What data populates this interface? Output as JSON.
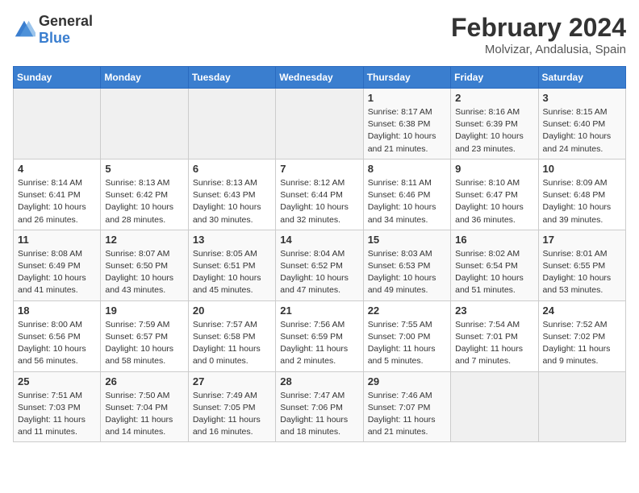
{
  "logo": {
    "text_general": "General",
    "text_blue": "Blue"
  },
  "title": {
    "month": "February 2024",
    "location": "Molvizar, Andalusia, Spain"
  },
  "weekdays": [
    "Sunday",
    "Monday",
    "Tuesday",
    "Wednesday",
    "Thursday",
    "Friday",
    "Saturday"
  ],
  "weeks": [
    [
      {
        "day": "",
        "info": ""
      },
      {
        "day": "",
        "info": ""
      },
      {
        "day": "",
        "info": ""
      },
      {
        "day": "",
        "info": ""
      },
      {
        "day": "1",
        "info": "Sunrise: 8:17 AM\nSunset: 6:38 PM\nDaylight: 10 hours and 21 minutes."
      },
      {
        "day": "2",
        "info": "Sunrise: 8:16 AM\nSunset: 6:39 PM\nDaylight: 10 hours and 23 minutes."
      },
      {
        "day": "3",
        "info": "Sunrise: 8:15 AM\nSunset: 6:40 PM\nDaylight: 10 hours and 24 minutes."
      }
    ],
    [
      {
        "day": "4",
        "info": "Sunrise: 8:14 AM\nSunset: 6:41 PM\nDaylight: 10 hours and 26 minutes."
      },
      {
        "day": "5",
        "info": "Sunrise: 8:13 AM\nSunset: 6:42 PM\nDaylight: 10 hours and 28 minutes."
      },
      {
        "day": "6",
        "info": "Sunrise: 8:13 AM\nSunset: 6:43 PM\nDaylight: 10 hours and 30 minutes."
      },
      {
        "day": "7",
        "info": "Sunrise: 8:12 AM\nSunset: 6:44 PM\nDaylight: 10 hours and 32 minutes."
      },
      {
        "day": "8",
        "info": "Sunrise: 8:11 AM\nSunset: 6:46 PM\nDaylight: 10 hours and 34 minutes."
      },
      {
        "day": "9",
        "info": "Sunrise: 8:10 AM\nSunset: 6:47 PM\nDaylight: 10 hours and 36 minutes."
      },
      {
        "day": "10",
        "info": "Sunrise: 8:09 AM\nSunset: 6:48 PM\nDaylight: 10 hours and 39 minutes."
      }
    ],
    [
      {
        "day": "11",
        "info": "Sunrise: 8:08 AM\nSunset: 6:49 PM\nDaylight: 10 hours and 41 minutes."
      },
      {
        "day": "12",
        "info": "Sunrise: 8:07 AM\nSunset: 6:50 PM\nDaylight: 10 hours and 43 minutes."
      },
      {
        "day": "13",
        "info": "Sunrise: 8:05 AM\nSunset: 6:51 PM\nDaylight: 10 hours and 45 minutes."
      },
      {
        "day": "14",
        "info": "Sunrise: 8:04 AM\nSunset: 6:52 PM\nDaylight: 10 hours and 47 minutes."
      },
      {
        "day": "15",
        "info": "Sunrise: 8:03 AM\nSunset: 6:53 PM\nDaylight: 10 hours and 49 minutes."
      },
      {
        "day": "16",
        "info": "Sunrise: 8:02 AM\nSunset: 6:54 PM\nDaylight: 10 hours and 51 minutes."
      },
      {
        "day": "17",
        "info": "Sunrise: 8:01 AM\nSunset: 6:55 PM\nDaylight: 10 hours and 53 minutes."
      }
    ],
    [
      {
        "day": "18",
        "info": "Sunrise: 8:00 AM\nSunset: 6:56 PM\nDaylight: 10 hours and 56 minutes."
      },
      {
        "day": "19",
        "info": "Sunrise: 7:59 AM\nSunset: 6:57 PM\nDaylight: 10 hours and 58 minutes."
      },
      {
        "day": "20",
        "info": "Sunrise: 7:57 AM\nSunset: 6:58 PM\nDaylight: 11 hours and 0 minutes."
      },
      {
        "day": "21",
        "info": "Sunrise: 7:56 AM\nSunset: 6:59 PM\nDaylight: 11 hours and 2 minutes."
      },
      {
        "day": "22",
        "info": "Sunrise: 7:55 AM\nSunset: 7:00 PM\nDaylight: 11 hours and 5 minutes."
      },
      {
        "day": "23",
        "info": "Sunrise: 7:54 AM\nSunset: 7:01 PM\nDaylight: 11 hours and 7 minutes."
      },
      {
        "day": "24",
        "info": "Sunrise: 7:52 AM\nSunset: 7:02 PM\nDaylight: 11 hours and 9 minutes."
      }
    ],
    [
      {
        "day": "25",
        "info": "Sunrise: 7:51 AM\nSunset: 7:03 PM\nDaylight: 11 hours and 11 minutes."
      },
      {
        "day": "26",
        "info": "Sunrise: 7:50 AM\nSunset: 7:04 PM\nDaylight: 11 hours and 14 minutes."
      },
      {
        "day": "27",
        "info": "Sunrise: 7:49 AM\nSunset: 7:05 PM\nDaylight: 11 hours and 16 minutes."
      },
      {
        "day": "28",
        "info": "Sunrise: 7:47 AM\nSunset: 7:06 PM\nDaylight: 11 hours and 18 minutes."
      },
      {
        "day": "29",
        "info": "Sunrise: 7:46 AM\nSunset: 7:07 PM\nDaylight: 11 hours and 21 minutes."
      },
      {
        "day": "",
        "info": ""
      },
      {
        "day": "",
        "info": ""
      }
    ]
  ]
}
